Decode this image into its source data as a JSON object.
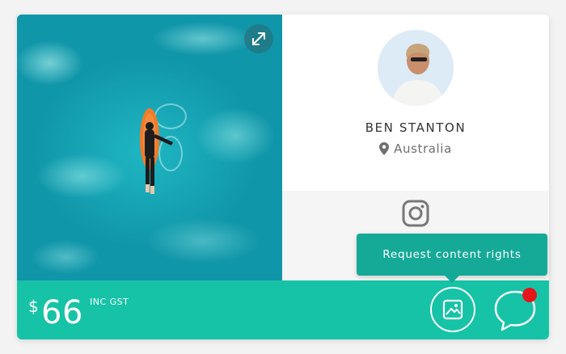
{
  "photographer": {
    "name": "BEN STANTON",
    "location": "Australia"
  },
  "pricing": {
    "currency_symbol": "$",
    "amount": "66",
    "tax_note": "INC GST"
  },
  "tooltip": {
    "text": "Request content rights"
  },
  "icons": {
    "expand": "expand-icon",
    "location": "location-pin-icon",
    "social": "instagram-icon",
    "rights": "image-icon",
    "chat": "chat-bubble-icon"
  },
  "notifications": {
    "has_unread": true
  },
  "colors": {
    "accent": "#17c3a6",
    "tooltip": "#15a997",
    "notification": "#e4161b"
  }
}
